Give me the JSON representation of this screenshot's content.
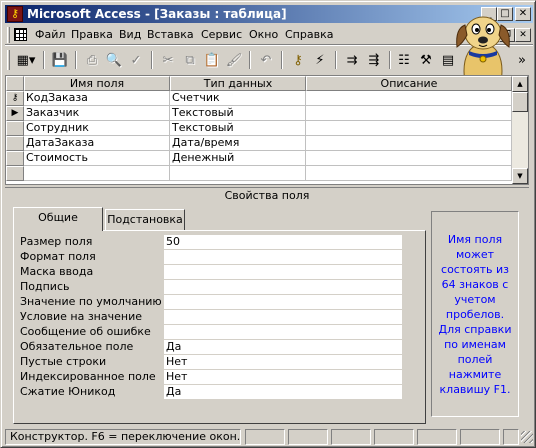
{
  "window": {
    "title": "Microsoft Access - [Заказы : таблица]",
    "app_icon": "key-icon"
  },
  "menu": {
    "items": [
      "Файл",
      "Правка",
      "Вид",
      "Вставка",
      "Сервис",
      "Окно",
      "Справка"
    ]
  },
  "toolbar": {
    "icons": [
      "view-icon",
      "save-icon",
      "print-icon",
      "print-preview-icon",
      "spelling-icon",
      "cut-icon",
      "copy-icon",
      "paste-icon",
      "format-painter-icon",
      "undo-icon",
      "primary-key-icon",
      "indexes-icon",
      "insert-rows-icon",
      "delete-rows-icon",
      "properties-icon",
      "build-icon",
      "database-window-icon",
      "new-object-icon",
      "help-icon",
      "more-icon"
    ]
  },
  "grid": {
    "headers": [
      "Имя поля",
      "Тип данных",
      "Описание"
    ],
    "rows": [
      {
        "name": "КодЗаказа",
        "type": "Счетчик",
        "desc": "",
        "selector": "key"
      },
      {
        "name": "Заказчик",
        "type": "Текстовый",
        "desc": "",
        "selector": "current"
      },
      {
        "name": "Сотрудник",
        "type": "Текстовый",
        "desc": "",
        "selector": ""
      },
      {
        "name": "ДатаЗаказа",
        "type": "Дата/время",
        "desc": "",
        "selector": ""
      },
      {
        "name": "Стоимость",
        "type": "Денежный",
        "desc": "",
        "selector": ""
      }
    ]
  },
  "properties": {
    "caption": "Свойства поля",
    "tabs": [
      "Общие",
      "Подстановка"
    ],
    "active_tab": "Общие",
    "rows": [
      {
        "label": "Размер поля",
        "value": "50"
      },
      {
        "label": "Формат поля",
        "value": ""
      },
      {
        "label": "Маска ввода",
        "value": ""
      },
      {
        "label": "Подпись",
        "value": ""
      },
      {
        "label": "Значение по умолчанию",
        "value": ""
      },
      {
        "label": "Условие на значение",
        "value": ""
      },
      {
        "label": "Сообщение об ошибке",
        "value": ""
      },
      {
        "label": "Обязательное поле",
        "value": "Да"
      },
      {
        "label": "Пустые строки",
        "value": "Нет"
      },
      {
        "label": "Индексированное поле",
        "value": "Нет"
      },
      {
        "label": "Сжатие Юникод",
        "value": "Да"
      }
    ],
    "help_text": "Имя поля может состоять из 64 знаков с учетом пробелов. Для справки по именам полей нажмите клавишу F1."
  },
  "status": {
    "text": "Конструктор.  F6 = переключение окон.  F1"
  },
  "colors": {
    "title_start": "#0a246a",
    "title_end": "#a6caf0",
    "help_text": "#0000ff",
    "face": "#d4d0c8"
  }
}
